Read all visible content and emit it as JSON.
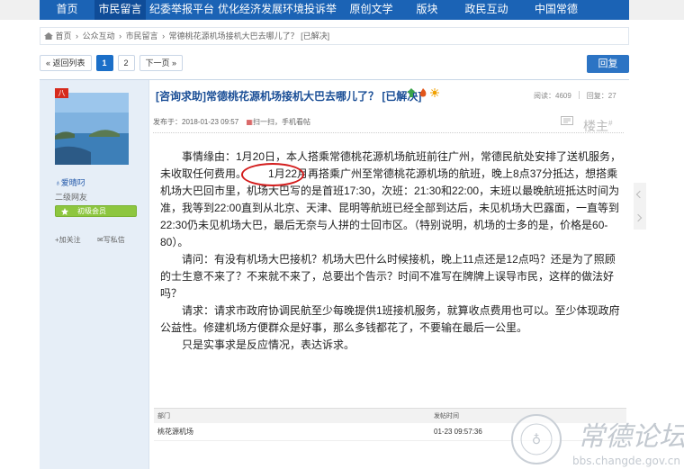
{
  "nav": {
    "items": [
      "首页",
      "市民留言",
      "纪委举报平台",
      "优化经济发展环境投诉举报",
      "原创文学",
      "版块",
      "政民互动",
      "中国常德"
    ],
    "active_index": 1,
    "color": "#1b63b5"
  },
  "breadcrumb": {
    "items": [
      "首页",
      "›",
      "公众互动",
      "›",
      "市民留言",
      "›",
      "常德桃花源机场接机大巴去哪儿了？ [已解决]"
    ]
  },
  "pager": {
    "back_label": "« 返回列表",
    "pages": [
      "1",
      "2"
    ],
    "current": "1",
    "next_label": "下一页 »"
  },
  "reply_label": "回复",
  "user": {
    "badge": "八",
    "name": "爱晴叼",
    "level": "二级网友",
    "vip_label": "初级会员",
    "follow_label": "加关注",
    "message_label": "写私信"
  },
  "post": {
    "title": "[咨询求助]常德桃花源机场接机大巴去哪儿了？ [已解决]",
    "views_label": "阅读：4609",
    "replies_label": "回复：27",
    "posted": "发布于：2018-01-23 09:57",
    "scan_label": "扫一扫，手机看帖",
    "floor": "楼主",
    "paragraph1_pre": "事情缘由：1月20日，本人搭乘常德桃花源机场航班前往广州，常德民航处安排了送机服务，未收取任何费用。",
    "paragraph1_circled": "1月22月",
    "paragraph1_post": "再搭乘广州至常德桃花源机场的航班，晚上8点37分抵达，想搭乘机场大巴回市里，机场大巴写的是首班17:30，次班：21:30和22:00，末班以最晚航班抵达时间为准，我等到22:00直到从北京、天津、昆明等航班已经全部到达后，未见机场大巴露面，一直等到22:30仍未见机场大巴，最后无奈与人拼的士回市区。（特别说明，机场的士多的是，价格是60-80）。",
    "paragraph2": "请问：有没有机场大巴接机？机场大巴什么时候接机，晚上11点还是12点吗？还是为了照顾的士生意不来了？不来就不来了，总要出个告示？时间不准写在牌牌上误导市民，这样的做法好吗？",
    "paragraph3": "请求：请求市政府协调民航至少每晚提供1班接机服务，就算收点费用也可以。至少体现政府公益性。修建机场方便群众是好事，那么多钱都花了，不要输在最后一公里。",
    "paragraph4": "只是实事求是反应情况，表达诉求。"
  },
  "table": {
    "headers": [
      "部门",
      "发帖时间"
    ],
    "rows": [
      [
        "桃花源机场",
        "01-23 09:57:36"
      ]
    ]
  },
  "watermark": {
    "title": "常德论坛",
    "url": "bbs.changde.gov.cn"
  }
}
